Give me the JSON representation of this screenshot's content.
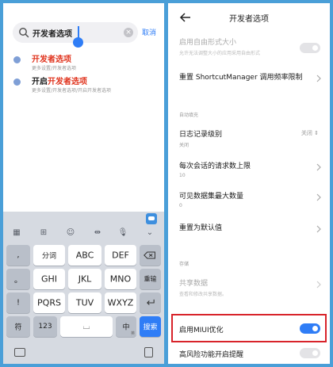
{
  "left": {
    "search": {
      "value": "开发者选项",
      "cancel_label": "取消"
    },
    "results": [
      {
        "prefix": "",
        "highlight": "开发者选项",
        "subtitle": "更多设置/开发者选项"
      },
      {
        "prefix": "开启",
        "highlight": "开发者选项",
        "subtitle": "更多设置/开发者选项/开启开发者选项"
      }
    ],
    "keyboard": {
      "row1": [
        ",",
        "分词",
        "ABC",
        "DEF"
      ],
      "row2": [
        "。",
        "GHI",
        "JKL",
        "MNO",
        "重输"
      ],
      "row3": [
        "!",
        "PQRS",
        "TUV",
        "WXYZ"
      ],
      "row4": [
        "符",
        "123",
        "中",
        "搜索"
      ],
      "space_label": "⌴",
      "mode_sub": "英"
    }
  },
  "right": {
    "title": "开发者选项",
    "top_row": {
      "title": "启用自由形式大小",
      "subtitle": "允许无法调整大小的应用采用自由形式"
    },
    "reset_shortcut": "重置 ShortcutManager 调用频率限制",
    "section_auto": "自动填充",
    "log_level": {
      "title": "日志记录级别",
      "subtitle": "关闭",
      "value": "关闭"
    },
    "max_requests": {
      "title": "每次会话的请求数上限",
      "subtitle": "10"
    },
    "max_datasets": {
      "title": "可见数据集最大数量",
      "subtitle": "0"
    },
    "reset_default": "重置为默认值",
    "section_share": "存储",
    "shared_data": {
      "title": "共享数据",
      "subtitle": "查看和修改共享数据。"
    },
    "miui_opt": {
      "title": "启用MIUI优化",
      "on": true
    },
    "high_risk": {
      "title": "高风险功能开启提醒",
      "on": false
    }
  }
}
